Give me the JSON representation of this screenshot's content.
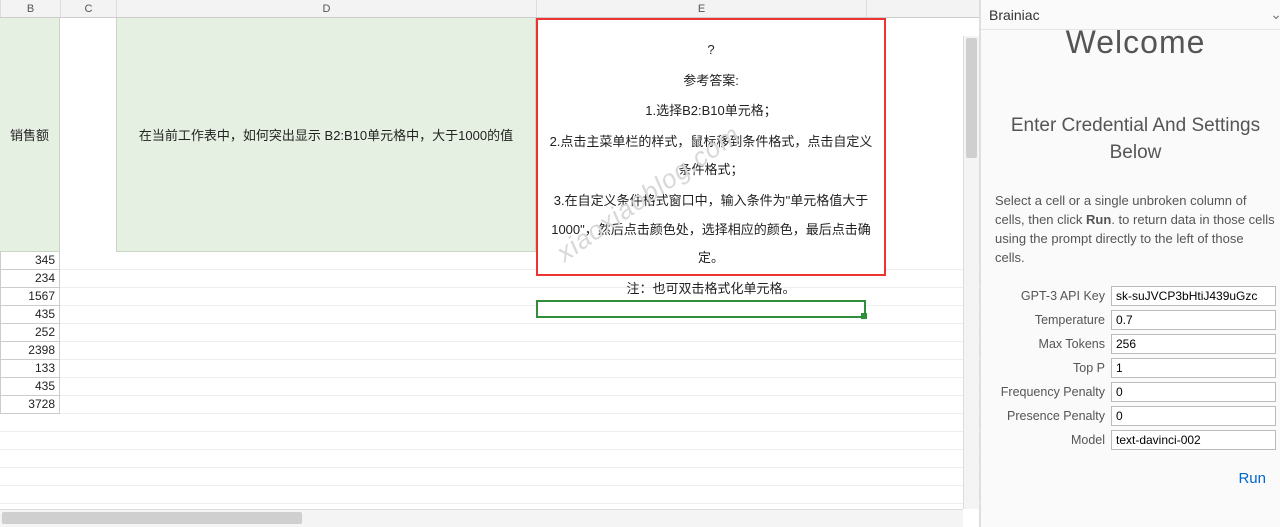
{
  "columns": {
    "B": "B",
    "C": "C",
    "D": "D",
    "E": "E"
  },
  "sheet": {
    "b_header": "销售额",
    "d_text": "在当前工作表中，如何突出显示 B2:B10单元格中，大于1000的值",
    "e_box": {
      "q": "?",
      "title": "参考答案:",
      "step1": "1.选择B2:B10单元格；",
      "step2": "2.点击主菜单栏的样式，鼠标移到条件格式，点击自定义条件格式；",
      "step3": "3.在自定义条件格式窗口中，输入条件为\"单元格值大于1000\"，然后点击颜色处，选择相应的颜色，最后点击确定。",
      "note": "注：也可双击格式化单元格。"
    },
    "b_values": [
      "345",
      "234",
      "1567",
      "435",
      "252",
      "2398",
      "133",
      "435",
      "3728"
    ]
  },
  "watermark": "xiaoxiaoblog.com",
  "pane": {
    "title": "Brainiac",
    "welcome": "Welcome",
    "cred_heading": "Enter Credential And Settings Below",
    "desc_pre": "Select a cell or a single unbroken column of cells, then click ",
    "desc_bold": "Run",
    "desc_post": ". to return data in those cells using the prompt directly to the left of those cells.",
    "fields": {
      "api_key": {
        "label": "GPT-3 API Key",
        "value": "sk-suJVCP3bHtiJ439uGzc"
      },
      "temp": {
        "label": "Temperature",
        "value": "0.7"
      },
      "tokens": {
        "label": "Max Tokens",
        "value": "256"
      },
      "top_p": {
        "label": "Top P",
        "value": "1"
      },
      "freq": {
        "label": "Frequency Penalty",
        "value": "0"
      },
      "pres": {
        "label": "Presence Penalty",
        "value": "0"
      },
      "model": {
        "label": "Model",
        "value": "text-davinci-002"
      }
    },
    "run": "Run"
  }
}
